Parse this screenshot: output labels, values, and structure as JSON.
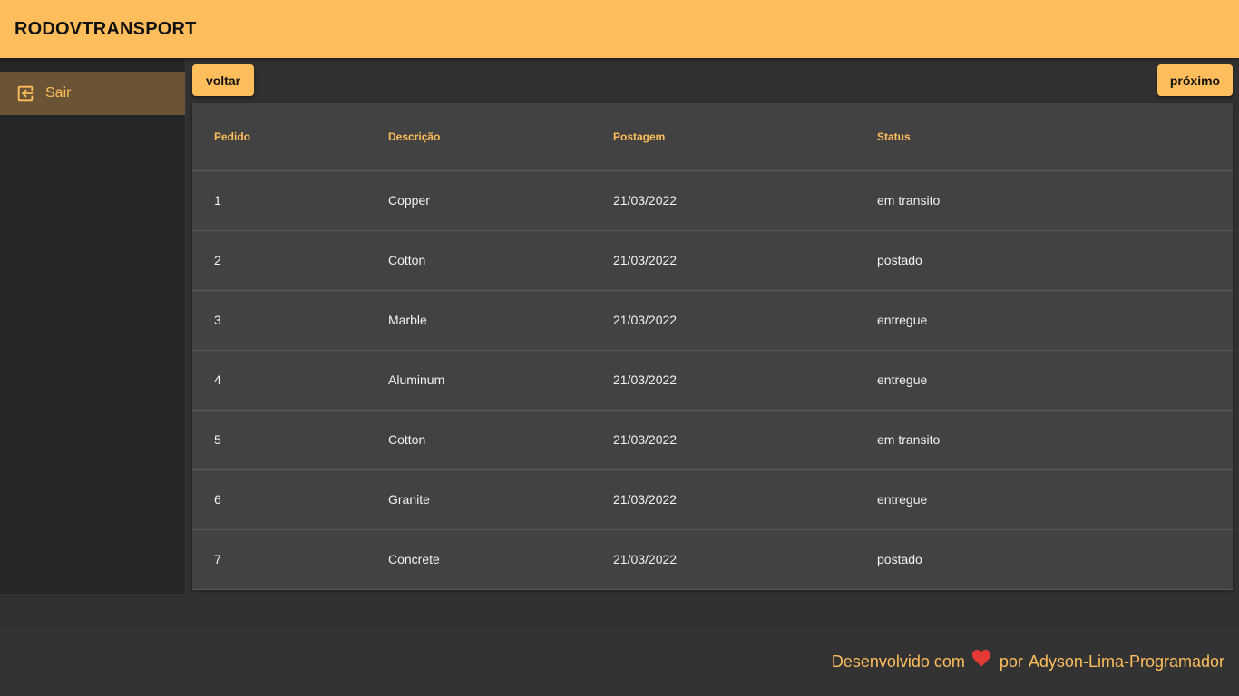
{
  "header": {
    "title": "RODOVTRANSPORT"
  },
  "sidebar": {
    "items": [
      {
        "label": "Sair",
        "icon": "logout-icon"
      }
    ]
  },
  "pagination": {
    "prev_label": "voltar",
    "next_label": "próximo"
  },
  "table": {
    "columns": [
      "Pedido",
      "Descrição",
      "Postagem",
      "Status"
    ],
    "rows": [
      {
        "pedido": "1",
        "descricao": "Copper",
        "postagem": "21/03/2022",
        "status": "em transito"
      },
      {
        "pedido": "2",
        "descricao": "Cotton",
        "postagem": "21/03/2022",
        "status": "postado"
      },
      {
        "pedido": "3",
        "descricao": "Marble",
        "postagem": "21/03/2022",
        "status": "entregue"
      },
      {
        "pedido": "4",
        "descricao": "Aluminum",
        "postagem": "21/03/2022",
        "status": "entregue"
      },
      {
        "pedido": "5",
        "descricao": "Cotton",
        "postagem": "21/03/2022",
        "status": "em transito"
      },
      {
        "pedido": "6",
        "descricao": "Granite",
        "postagem": "21/03/2022",
        "status": "entregue"
      },
      {
        "pedido": "7",
        "descricao": "Concrete",
        "postagem": "21/03/2022",
        "status": "postado"
      }
    ]
  },
  "footer": {
    "prefix": "Desenvolvido com",
    "heart_icon": "heart-icon",
    "middle": "por",
    "author": "Adyson-Lima-Programador"
  },
  "colors": {
    "accent": "#ffbe5b",
    "heart": "#e53935",
    "background": "#303030",
    "table_bg": "#424242",
    "sidebar_bg": "#262626",
    "active_item_bg": "#6a5435"
  }
}
